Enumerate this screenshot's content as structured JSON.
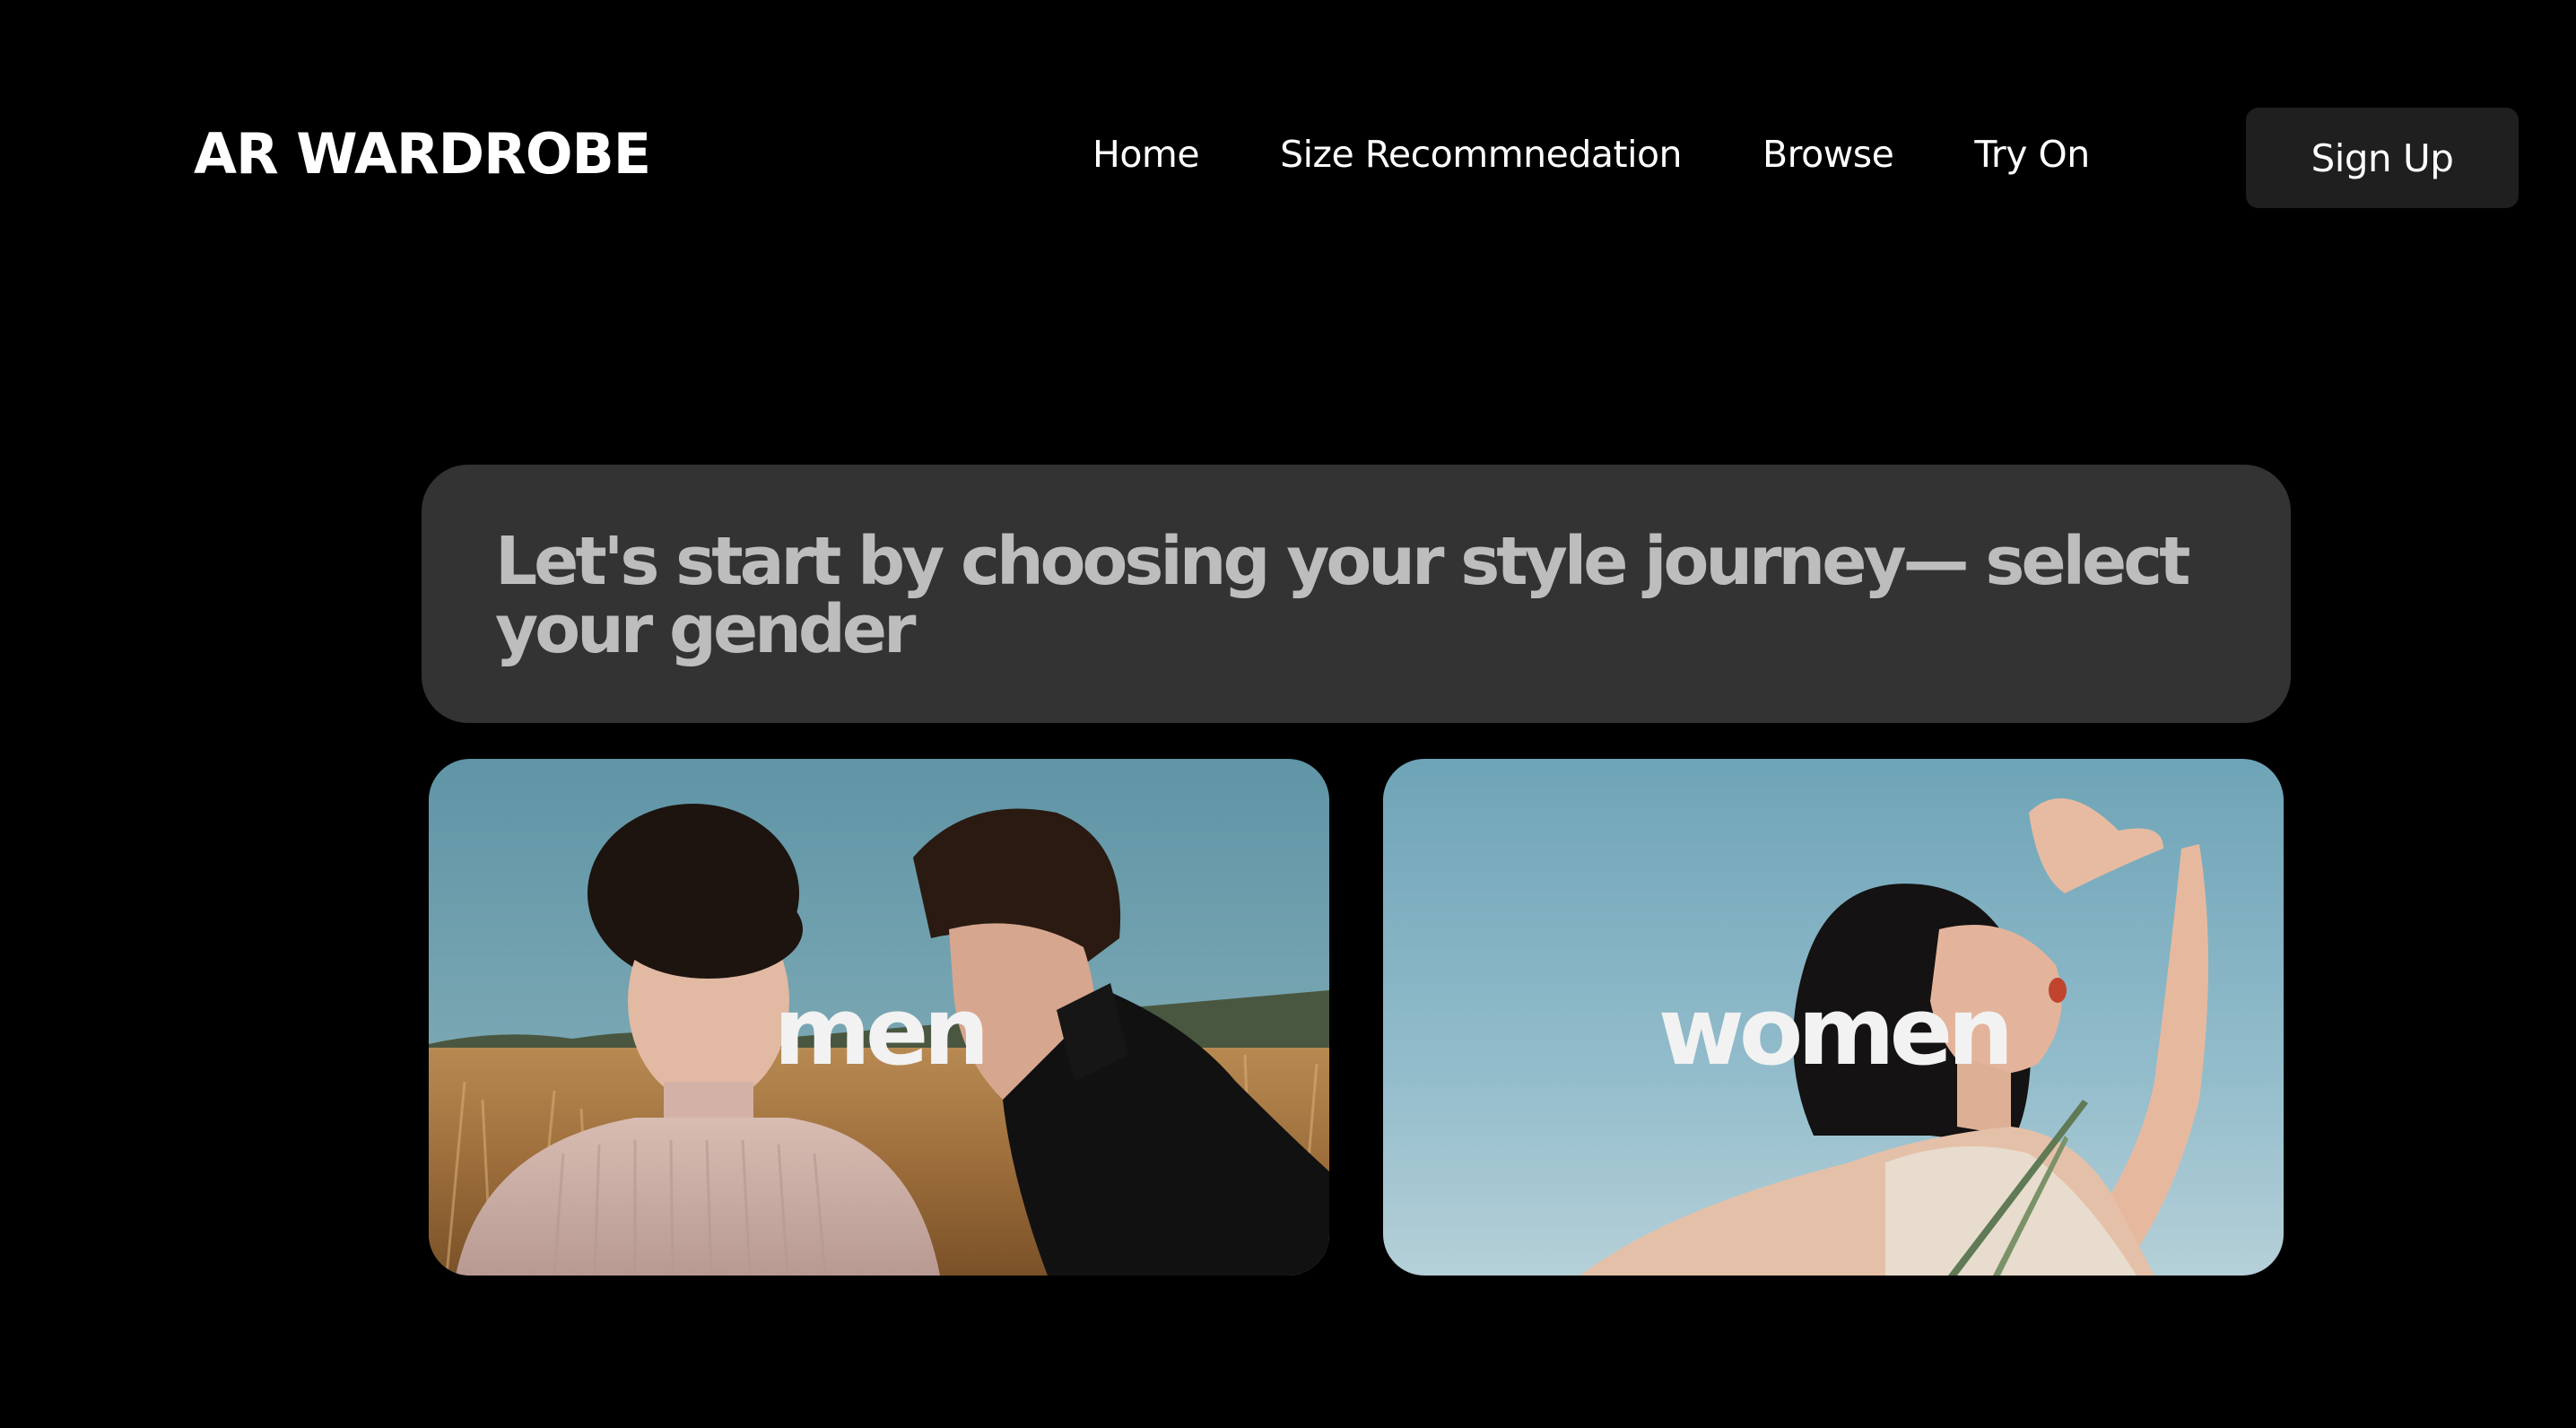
{
  "header": {
    "brand": "AR WARDROBE",
    "nav": [
      {
        "label": "Home"
      },
      {
        "label": "Size Recommnedation"
      },
      {
        "label": "Browse"
      },
      {
        "label": "Try On"
      }
    ],
    "signup_label": "Sign Up"
  },
  "main": {
    "prompt": "Let's start by choosing your style journey— select your gender",
    "cards": [
      {
        "label": "men",
        "photo": "two-men-in-wheat-field"
      },
      {
        "label": "women",
        "photo": "woman-under-blue-sky"
      }
    ]
  },
  "colors": {
    "background": "#000000",
    "prompt_bg": "#333333",
    "prompt_text": "#bdbdbd",
    "button_bg": "#1f1f1f",
    "text": "#ffffff"
  }
}
